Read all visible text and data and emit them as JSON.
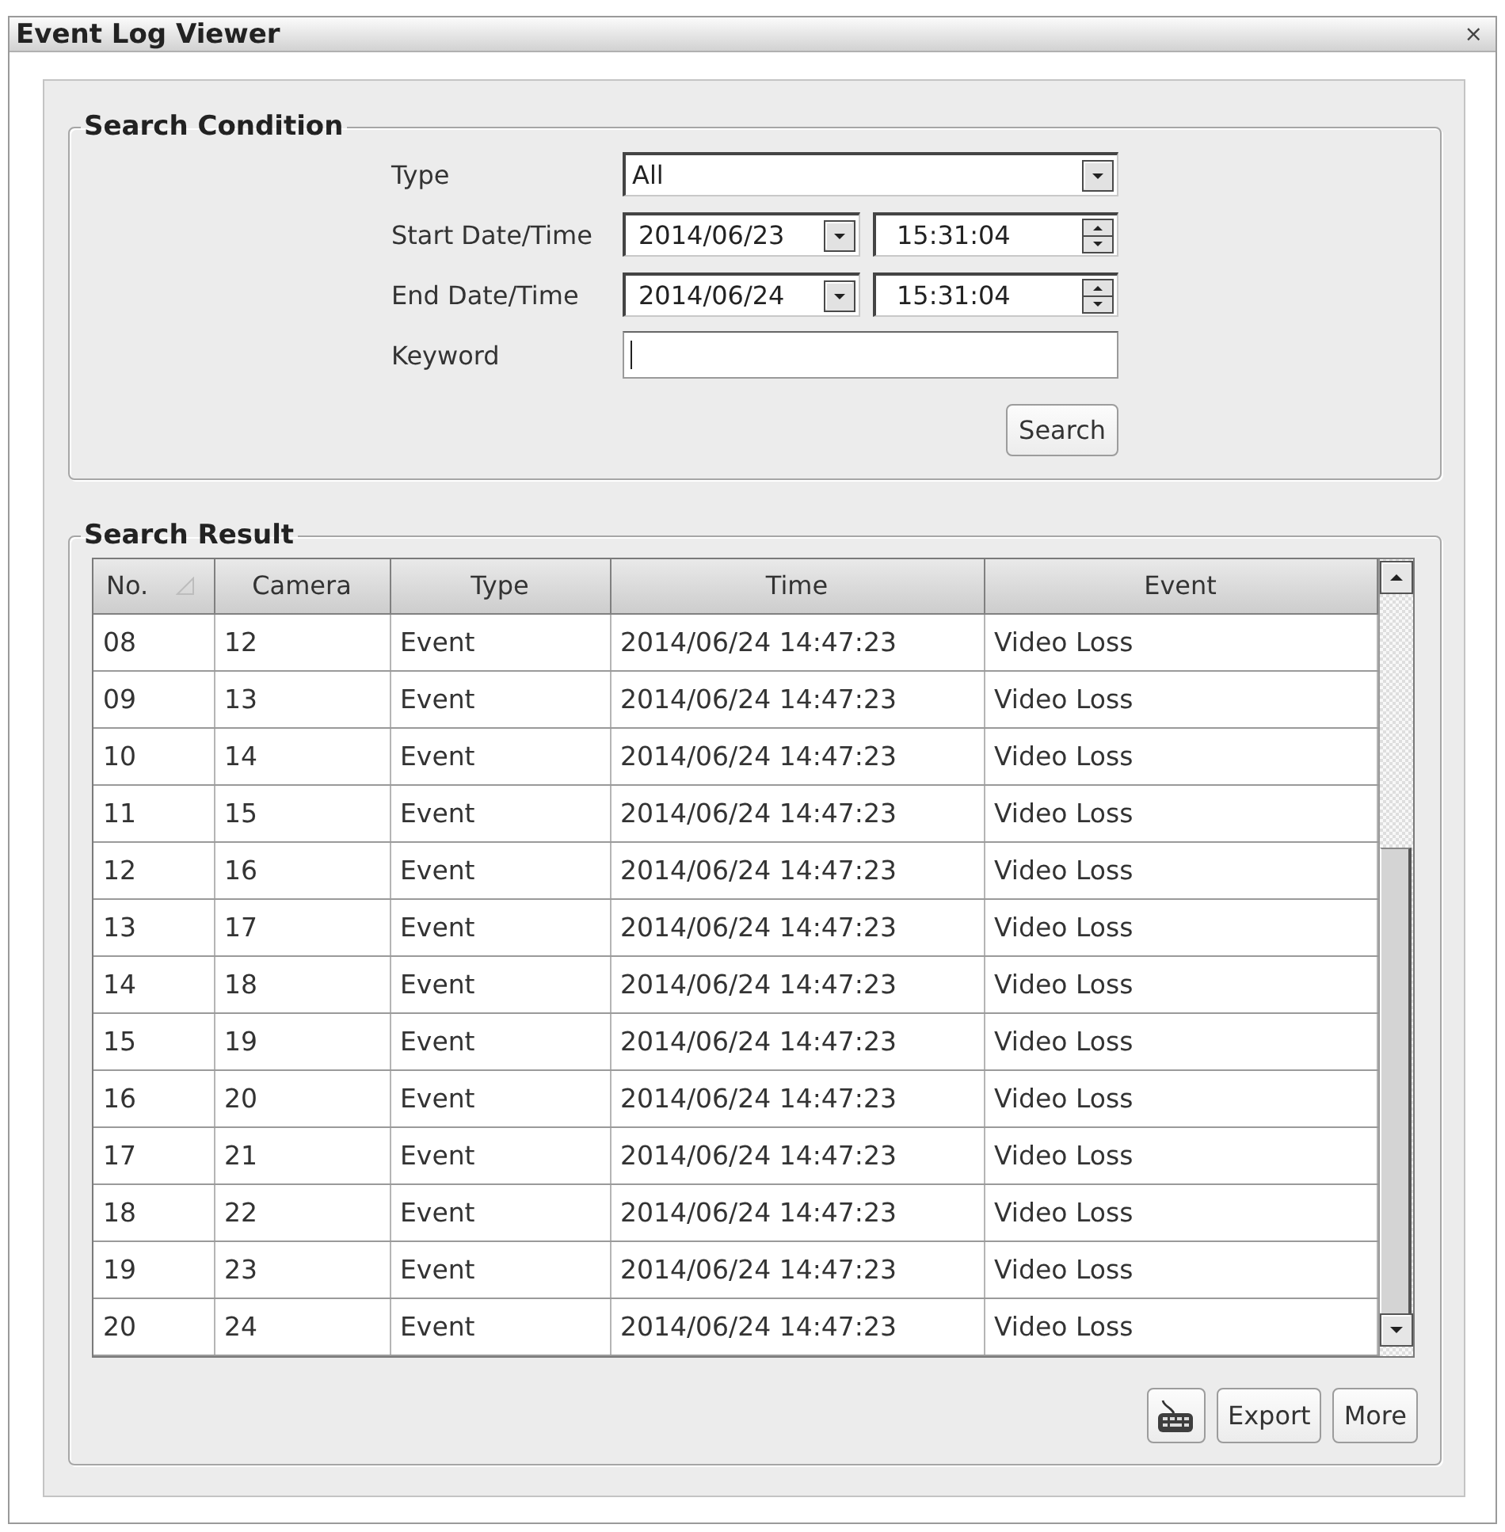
{
  "window": {
    "title": "Event Log Viewer",
    "close": "×"
  },
  "search_condition": {
    "title": "Search Condition",
    "fields": [
      {
        "kind": "dropdown",
        "label": "Type",
        "value": "All"
      },
      {
        "kind": "datetime",
        "label": "Start Date/Time",
        "date": "2014/06/23",
        "time": "15:31:04"
      },
      {
        "kind": "datetime",
        "label": "End Date/Time",
        "date": "2014/06/24",
        "time": "15:31:04"
      },
      {
        "kind": "text",
        "label": "Keyword",
        "focused": true
      }
    ],
    "button": "Search"
  },
  "search_result": {
    "title": "Search Result",
    "table": {
      "columns": [
        {
          "label": "No.",
          "sorted": true
        },
        {
          "label": "Camera",
          "sorted": false
        },
        {
          "label": "Type",
          "sorted": false
        },
        {
          "label": "Time",
          "sorted": false
        },
        {
          "label": "Event",
          "sorted": false
        }
      ],
      "rows": [
        [
          "08",
          "12",
          "Event",
          "2014/06/24 14:47:23",
          "Video Loss"
        ],
        [
          "09",
          "13",
          "Event",
          "2014/06/24 14:47:23",
          "Video Loss"
        ],
        [
          "10",
          "14",
          "Event",
          "2014/06/24 14:47:23",
          "Video Loss"
        ],
        [
          "11",
          "15",
          "Event",
          "2014/06/24 14:47:23",
          "Video Loss"
        ],
        [
          "12",
          "16",
          "Event",
          "2014/06/24 14:47:23",
          "Video Loss"
        ],
        [
          "13",
          "17",
          "Event",
          "2014/06/24 14:47:23",
          "Video Loss"
        ],
        [
          "14",
          "18",
          "Event",
          "2014/06/24 14:47:23",
          "Video Loss"
        ],
        [
          "15",
          "19",
          "Event",
          "2014/06/24 14:47:23",
          "Video Loss"
        ],
        [
          "16",
          "20",
          "Event",
          "2014/06/24 14:47:23",
          "Video Loss"
        ],
        [
          "17",
          "21",
          "Event",
          "2014/06/24 14:47:23",
          "Video Loss"
        ],
        [
          "18",
          "22",
          "Event",
          "2014/06/24 14:47:23",
          "Video Loss"
        ],
        [
          "19",
          "23",
          "Event",
          "2014/06/24 14:47:23",
          "Video Loss"
        ],
        [
          "20",
          "24",
          "Event",
          "2014/06/24 14:47:23",
          "Video Loss"
        ]
      ]
    },
    "buttons": [
      {
        "kind": "icon"
      },
      {
        "kind": "text",
        "label": "Export"
      },
      {
        "kind": "text",
        "label": "More"
      }
    ]
  }
}
